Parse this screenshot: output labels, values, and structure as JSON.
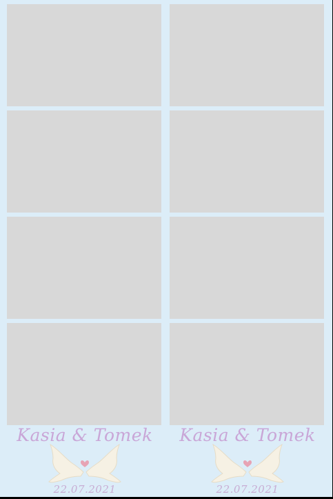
{
  "strips": [
    {
      "names": "Kasia & Tomek",
      "date": "22.07.2021"
    },
    {
      "names": "Kasia & Tomek",
      "date": "22.07.2021"
    }
  ],
  "colors": {
    "background": "#dcedf8",
    "photo_placeholder": "#d8d8d8",
    "script_text": "#c9a6d7",
    "dove": "#f6f1e4",
    "heart": "#e7a3b4"
  },
  "icons": [
    "doves-icon",
    "heart-icon"
  ]
}
